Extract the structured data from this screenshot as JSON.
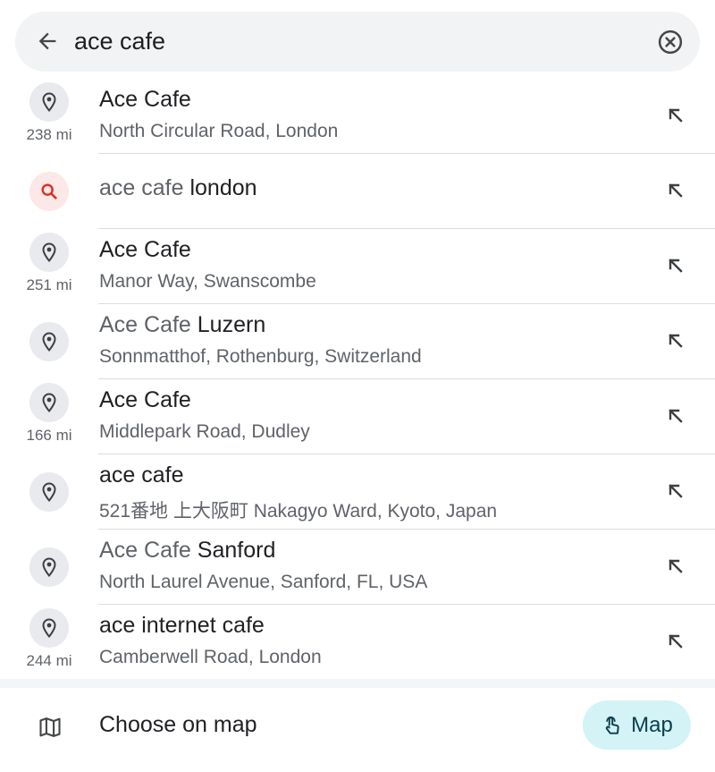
{
  "search": {
    "value": "ace cafe",
    "back_icon": "arrow-back-icon",
    "clear_icon": "clear-circle-icon"
  },
  "results": [
    {
      "type": "place",
      "icon": "place-pin-icon",
      "title_dim": "",
      "title_strong": "Ace Cafe",
      "subtitle": "North Circular Road, London",
      "distance": "238 mi"
    },
    {
      "type": "query",
      "icon": "search-icon",
      "title_dim": "ace cafe ",
      "title_strong": "london",
      "subtitle": "",
      "distance": ""
    },
    {
      "type": "place",
      "icon": "place-pin-icon",
      "title_dim": "",
      "title_strong": "Ace Cafe",
      "subtitle": "Manor Way, Swanscombe",
      "distance": "251 mi"
    },
    {
      "type": "place",
      "icon": "place-pin-icon",
      "title_dim": "Ace Cafe ",
      "title_strong": "Luzern",
      "subtitle": "Sonnmatthof, Rothenburg, Switzerland",
      "distance": ""
    },
    {
      "type": "place",
      "icon": "place-pin-icon",
      "title_dim": "",
      "title_strong": "Ace Cafe",
      "subtitle": "Middlepark Road, Dudley",
      "distance": "166 mi"
    },
    {
      "type": "place",
      "icon": "place-pin-icon",
      "title_dim": "",
      "title_strong": "ace cafe",
      "subtitle": "521番地 上大阪町 Nakagyo Ward, Kyoto, Japan",
      "distance": ""
    },
    {
      "type": "place",
      "icon": "place-pin-icon",
      "title_dim": "Ace Cafe ",
      "title_strong": "Sanford",
      "subtitle": "North Laurel Avenue, Sanford, FL, USA",
      "distance": ""
    },
    {
      "type": "place",
      "icon": "place-pin-icon",
      "title_dim": "",
      "title_strong": "ace internet cafe",
      "subtitle": "Camberwell Road, London",
      "distance": "244 mi"
    }
  ],
  "fill_icon": "arrow-up-left-icon",
  "footer": {
    "choose_label": "Choose on map",
    "choose_icon": "map-icon",
    "map_button_label": "Map",
    "map_button_icon": "touch-icon"
  },
  "colors": {
    "search_bar_bg": "#f1f3f4",
    "search_icon_red": "#d93025",
    "map_button_bg": "#d3f3f7"
  }
}
